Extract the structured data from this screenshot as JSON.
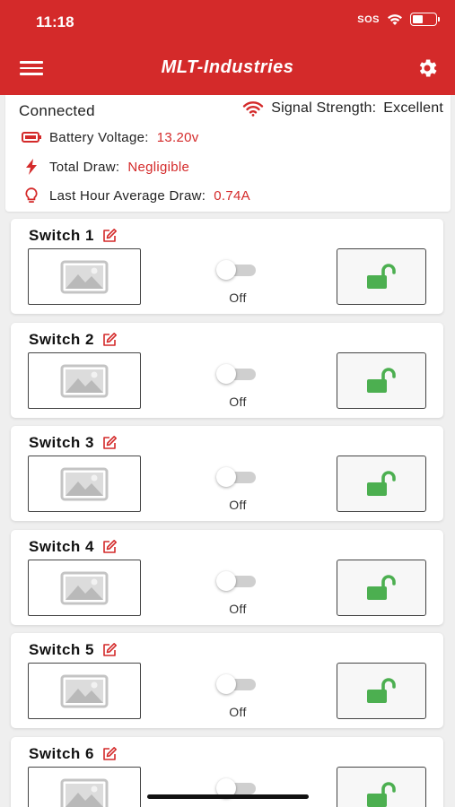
{
  "status_bar": {
    "time": "11:18",
    "sos": "SOS"
  },
  "header": {
    "title": "MLT-Industries"
  },
  "info": {
    "connection": "Connected",
    "signal_label": "Signal Strength:",
    "signal_value": "Excellent",
    "battery_label": "Battery Voltage:",
    "battery_value": "13.20v",
    "draw_label": "Total Draw:",
    "draw_value": "Negligible",
    "avg_label": "Last Hour Average Draw:",
    "avg_value": "0.74A"
  },
  "switches": [
    {
      "name": "Switch 1",
      "state": "Off"
    },
    {
      "name": "Switch 2",
      "state": "Off"
    },
    {
      "name": "Switch 3",
      "state": "Off"
    },
    {
      "name": "Switch 4",
      "state": "Off"
    },
    {
      "name": "Switch 5",
      "state": "Off"
    },
    {
      "name": "Switch 6",
      "state": "Off"
    }
  ],
  "colors": {
    "brand": "#d42a2a",
    "unlock": "#4caf50",
    "accent_text": "#d42a2a"
  },
  "icons": [
    "menu-icon",
    "gear-icon",
    "wifi-icon",
    "battery-icon",
    "bolt-icon",
    "bulb-icon",
    "edit-icon",
    "image-placeholder-icon",
    "unlock-icon"
  ]
}
